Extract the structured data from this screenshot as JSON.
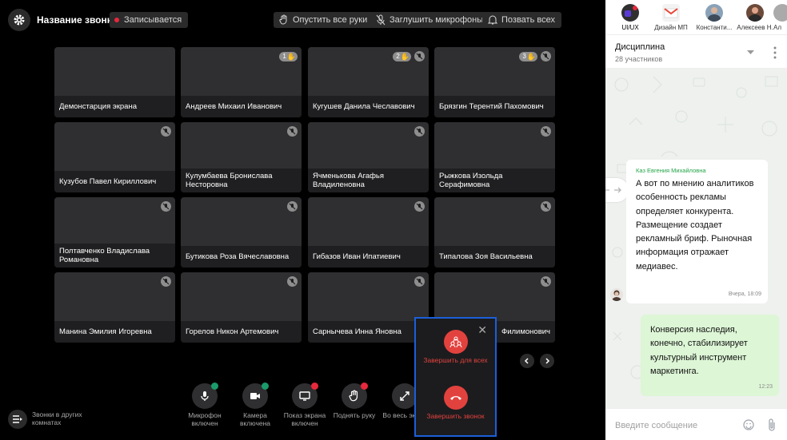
{
  "call": {
    "title": "Название звонка",
    "recording": "Записывается",
    "actions": {
      "lower_hands": "Опустить все руки",
      "mute_all": "Заглушить микрофоны",
      "call_all": "Позвать всех"
    },
    "participants": [
      {
        "name": "Демонстарция экрана",
        "muted": false,
        "hand": ""
      },
      {
        "name": "Андреев Михаил Иванович",
        "muted": false,
        "hand": "1"
      },
      {
        "name": "Кугушев Данила Чеславович",
        "muted": true,
        "hand": "2"
      },
      {
        "name": "Брязгин Терентий Пахомович",
        "muted": true,
        "hand": "3"
      },
      {
        "name": "Кузубов Павел Кириллович",
        "muted": true,
        "hand": ""
      },
      {
        "name": "Кулумбаева Бронислава Несторовна",
        "muted": true,
        "hand": ""
      },
      {
        "name": "Ячменькова Агафья Владиленовна",
        "muted": true,
        "hand": ""
      },
      {
        "name": "Рыжкова Изольда Серафимовна",
        "muted": true,
        "hand": ""
      },
      {
        "name": "Полтавченко Владислава Романовна",
        "muted": true,
        "hand": ""
      },
      {
        "name": "Бутикова Роза Вячеславовна",
        "muted": true,
        "hand": ""
      },
      {
        "name": "Гибазов Иван Ипатиевич",
        "muted": true,
        "hand": ""
      },
      {
        "name": "Типалова Зоя Васильевна",
        "muted": true,
        "hand": ""
      },
      {
        "name": "Манина Эмилия Игоревна",
        "muted": true,
        "hand": ""
      },
      {
        "name": "Горелов Никон Артемович",
        "muted": true,
        "hand": ""
      },
      {
        "name": "Сарнычева Инна Яновна",
        "muted": true,
        "hand": ""
      },
      {
        "name": "Филимонович",
        "muted": true,
        "hand": ""
      }
    ],
    "controls": {
      "mic": "Микрофон включен",
      "camera": "Камера включена",
      "screen": "Показ экрана включен",
      "hand": "Поднять руку",
      "fullscreen": "Во весь экран"
    },
    "other_rooms": "Звонки в других комнатах",
    "end_menu": {
      "end_for_all": "Завершить для всех",
      "end_call": "Завершить звонок"
    },
    "colors": {
      "accent_red": "#e2423e",
      "status_green": "#1a9b6a",
      "status_red": "#e8283c",
      "highlight_blue": "#1b5fd9"
    }
  },
  "chat": {
    "tabs": [
      {
        "label": "UI/UX",
        "icon": "ui-ux-avatar",
        "active": true
      },
      {
        "label": "Дизайн МП",
        "icon": "gmail-avatar",
        "active": false
      },
      {
        "label": "Константи...",
        "icon": "person-avatar",
        "active": false
      },
      {
        "label": "Алексеев Н.",
        "icon": "person-avatar",
        "active": false
      },
      {
        "label": "Ал",
        "icon": "person-avatar",
        "active": false
      }
    ],
    "channel": "Дисциплина",
    "members": "28 участников",
    "messages": [
      {
        "author": "Каз Евгения Михайловна",
        "text": "А вот по мнению аналитиков особенность рекламы определяет конкурента. Размещение создает рекламный бриф. Рыночная информация отражает медиавес.",
        "time": "Вчера, 18:09"
      },
      {
        "author": "",
        "text": "Конверсия наследия, конечно, стабилизирует культурный инструмент маркетинга.",
        "time": "12:23"
      }
    ],
    "input_placeholder": "Введите сообщение"
  }
}
